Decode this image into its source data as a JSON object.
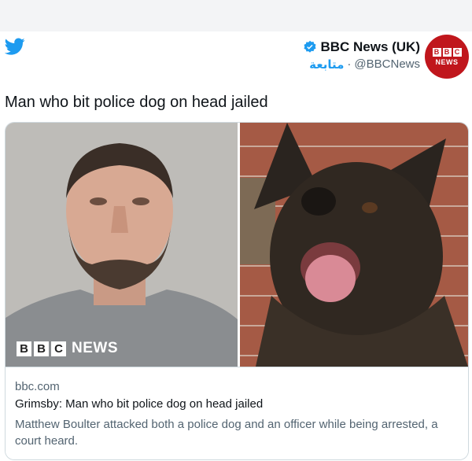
{
  "author": {
    "name": "BBC News (UK)",
    "handle": "@BBCNews",
    "follow_label": "متابعة",
    "separator": "·",
    "avatar_blocks": [
      "B",
      "B",
      "C"
    ],
    "avatar_text": "NEWS"
  },
  "tweet": {
    "text": "Man who bit police dog on head jailed"
  },
  "link_card": {
    "image_overlay_blocks": [
      "B",
      "B",
      "C"
    ],
    "image_overlay_text": "NEWS",
    "domain": "bbc.com",
    "title": "Grimsby: Man who bit police dog on head jailed",
    "description": "Matthew Boulter attacked both a police dog and an officer while being arrested, a court heard."
  },
  "colors": {
    "twitter_blue": "#1d9bf0",
    "bbc_red": "#c0161c",
    "secondary_text": "#536471",
    "border": "#cfd9de"
  },
  "icons": {
    "logo": "twitter-bird-icon",
    "verified": "verified-badge-icon"
  }
}
